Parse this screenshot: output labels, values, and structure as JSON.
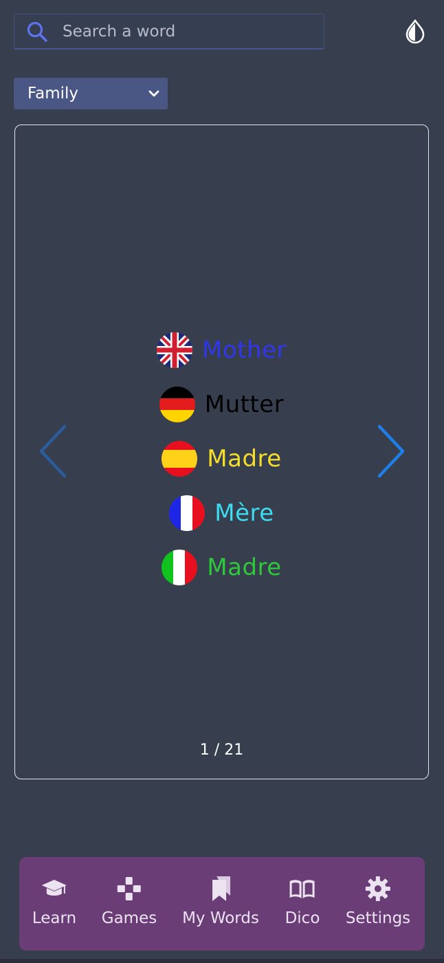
{
  "search": {
    "placeholder": "Search a word"
  },
  "category": {
    "selected": "Family"
  },
  "card": {
    "words": [
      {
        "lang": "English",
        "flag": "uk-flag-icon",
        "word": "Mother",
        "color": "#2f37e8"
      },
      {
        "lang": "German",
        "flag": "germany-flag-icon",
        "word": "Mutter",
        "color": "#000000"
      },
      {
        "lang": "Spanish",
        "flag": "spain-flag-icon",
        "word": "Madre",
        "color": "#f5de2a"
      },
      {
        "lang": "French",
        "flag": "france-flag-icon",
        "word": "Mère",
        "color": "#3ddbef"
      },
      {
        "lang": "Italian",
        "flag": "italy-flag-icon",
        "word": "Madre",
        "color": "#2ec83a"
      }
    ],
    "counter": "1 / 21"
  },
  "bottom_nav": {
    "items": [
      {
        "label": "Learn",
        "icon": "graduation-cap-icon"
      },
      {
        "label": "Games",
        "icon": "gamepad-icon"
      },
      {
        "label": "My Words",
        "icon": "bookmarks-icon"
      },
      {
        "label": "Dico",
        "icon": "open-book-icon"
      },
      {
        "label": "Settings",
        "icon": "gear-icon"
      }
    ]
  },
  "colors": {
    "background": "#373f4f",
    "accent_blue": "#1f7fe8",
    "nav_background": "#6a3d77"
  }
}
